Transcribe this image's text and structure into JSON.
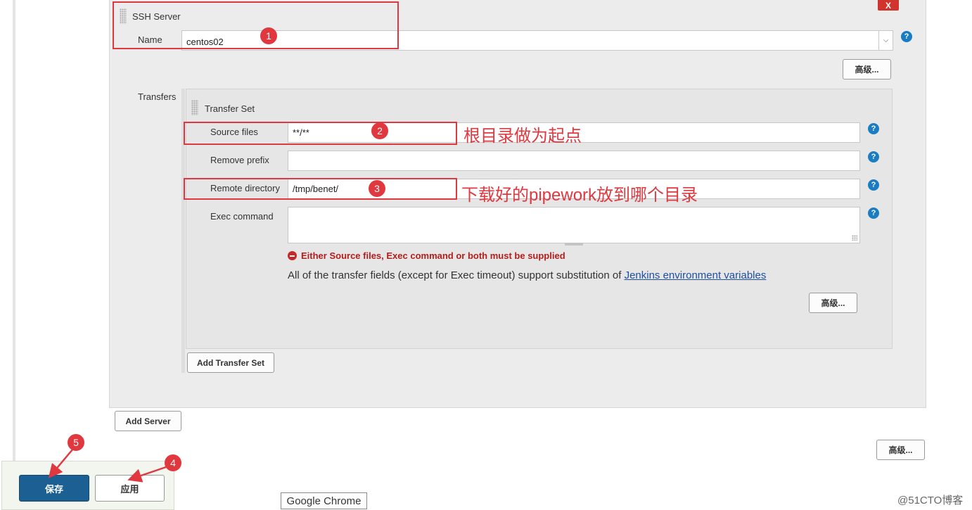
{
  "ssh_server": {
    "section_title": "SSH Server",
    "name_label": "Name",
    "name_value": "centos02",
    "delete_label": "X",
    "advanced_label": "高级..."
  },
  "transfers": {
    "label": "Transfers",
    "set_title": "Transfer Set",
    "source_files_label": "Source files",
    "source_files_value": "**/**",
    "remove_prefix_label": "Remove prefix",
    "remove_prefix_value": "",
    "remote_directory_label": "Remote directory",
    "remote_directory_value": "/tmp/benet/",
    "exec_command_label": "Exec command",
    "exec_command_value": "",
    "error_text": "Either Source files, Exec command or both must be supplied",
    "info_text": "All of the transfer fields (except for Exec timeout) support substitution of ",
    "info_link": "Jenkins environment variables",
    "advanced_label": "高级...",
    "add_transfer_set_label": "Add Transfer Set"
  },
  "add_server_label": "Add Server",
  "publisher_advanced_label": "高级...",
  "annotations": {
    "badge_1": "1",
    "badge_2": "2",
    "badge_3": "3",
    "badge_4": "4",
    "badge_5": "5",
    "note_source": "根目录做为起点",
    "note_remote": "下载好的pipework放到哪个目录"
  },
  "footer": {
    "save_label": "保存",
    "apply_label": "应用"
  },
  "tooltip": "Google Chrome",
  "watermark": "@51CTO博客",
  "help_glyph": "?",
  "select_glyph": "⌵",
  "colors": {
    "annotation_red": "#e0383e",
    "help_blue": "#1a7dc2",
    "save_blue": "#1b5f93",
    "error_red": "#b51c1c",
    "link_blue": "#1f4fa0"
  }
}
